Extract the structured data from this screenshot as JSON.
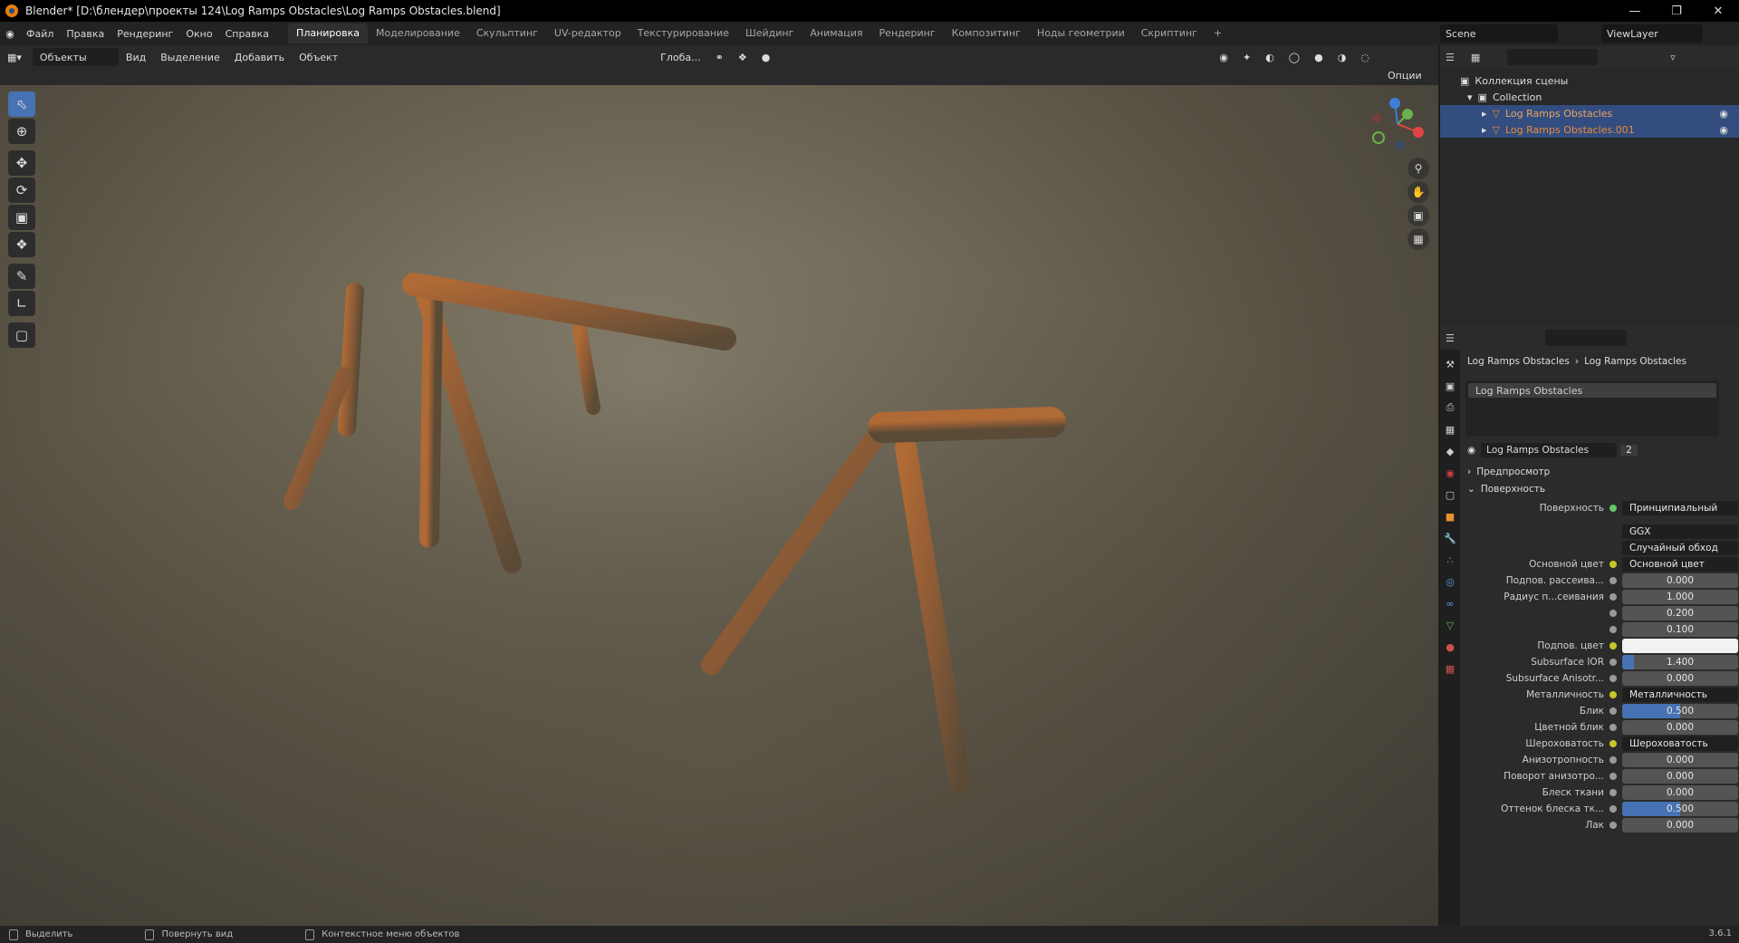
{
  "window": {
    "title": "Blender* [D:\\блендер\\проекты 124\\Log Ramps Obstacles\\Log Ramps Obstacles.blend]"
  },
  "menu": [
    "Файл",
    "Правка",
    "Рендеринг",
    "Окно",
    "Справка"
  ],
  "workspaces": [
    "Планировка",
    "Моделирование",
    "Скульптинг",
    "UV-редактор",
    "Текстурирование",
    "Шейдинг",
    "Анимация",
    "Рендеринг",
    "Композитинг",
    "Ноды геометрии",
    "Скриптинг"
  ],
  "scene": "Scene",
  "viewlayer": "ViewLayer",
  "viewport": {
    "mode": "Объекты",
    "menus": [
      "Вид",
      "Выделение",
      "Добавить",
      "Объект"
    ],
    "transform": "Глоба...",
    "options": "Опции"
  },
  "outliner": {
    "root": "Коллекция сцены",
    "collection": "Collection",
    "items": [
      "Log Ramps Obstacles",
      "Log Ramps Obstacles.001"
    ]
  },
  "properties": {
    "breadcrumb": [
      "Log Ramps Obstacles",
      "Log Ramps Obstacles"
    ],
    "slot": "Log Ramps Obstacles",
    "material": "Log Ramps Obstacles",
    "users": "2",
    "panel_preview": "Предпросмотр",
    "panel_surface": "Поверхность",
    "surface_label": "Поверхность",
    "surface_value": "Принципиальный BSDF",
    "distribution": "GGX",
    "subsurface_method": "Случайный обход",
    "rows": [
      {
        "label": "Основной цвет",
        "value": "Основной цвет",
        "kind": "link",
        "expand": true
      },
      {
        "label": "Подпов. рассеива...",
        "value": "0.000",
        "kind": "num"
      },
      {
        "label": "Радиус п...сеивания",
        "value": "1.000",
        "kind": "num"
      },
      {
        "label": "",
        "value": "0.200",
        "kind": "num"
      },
      {
        "label": "",
        "value": "0.100",
        "kind": "num"
      },
      {
        "label": "Подпов. цвет",
        "value": "",
        "kind": "color"
      },
      {
        "label": "Subsurface IOR",
        "value": "1.400",
        "kind": "num",
        "fill": 0.1
      },
      {
        "label": "Subsurface Anisotr...",
        "value": "0.000",
        "kind": "num"
      },
      {
        "label": "Металличность",
        "value": "Металличность",
        "kind": "link",
        "expand": true
      },
      {
        "label": "Блик",
        "value": "0.500",
        "kind": "num",
        "fill": 0.5
      },
      {
        "label": "Цветной блик",
        "value": "0.000",
        "kind": "num"
      },
      {
        "label": "Шероховатость",
        "value": "Шероховатость",
        "kind": "link",
        "expand": true
      },
      {
        "label": "Анизотропность",
        "value": "0.000",
        "kind": "num"
      },
      {
        "label": "Поворот анизотро...",
        "value": "0.000",
        "kind": "num"
      },
      {
        "label": "Блеск ткани",
        "value": "0.000",
        "kind": "num"
      },
      {
        "label": "Оттенок блеска тк...",
        "value": "0.500",
        "kind": "num",
        "fill": 0.5
      },
      {
        "label": "Лак",
        "value": "0.000",
        "kind": "num"
      }
    ]
  },
  "status": {
    "select": "Выделить",
    "rotate": "Повернуть вид",
    "context": "Контекстное меню объектов",
    "version": "3.6.1"
  }
}
